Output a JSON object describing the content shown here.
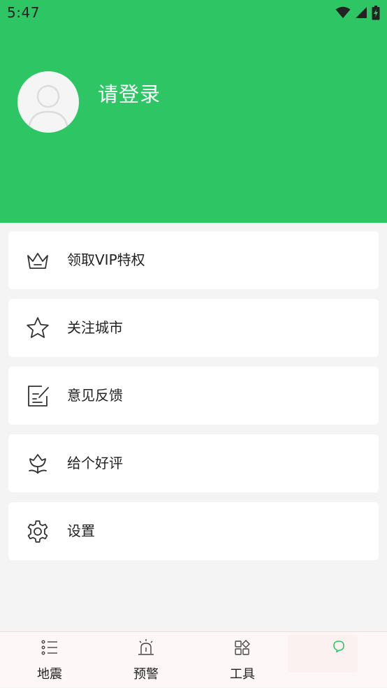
{
  "status": {
    "time": "5:47"
  },
  "profile": {
    "login_text": "请登录"
  },
  "menu": [
    {
      "label": "领取VIP特权",
      "icon": "crown-icon"
    },
    {
      "label": "关注城市",
      "icon": "star-icon"
    },
    {
      "label": "意见反馈",
      "icon": "feedback-icon"
    },
    {
      "label": "给个好评",
      "icon": "flower-icon"
    },
    {
      "label": "设置",
      "icon": "gear-icon"
    }
  ],
  "tabs": [
    {
      "label": "地震",
      "icon": "list-icon"
    },
    {
      "label": "预警",
      "icon": "alarm-icon"
    },
    {
      "label": "工具",
      "icon": "tools-icon"
    },
    {
      "label": "",
      "icon": "profile-bubble-icon"
    }
  ],
  "colors": {
    "brand": "#2ec664",
    "background": "#f4f4f4",
    "tabbar": "#fdf7f7"
  }
}
